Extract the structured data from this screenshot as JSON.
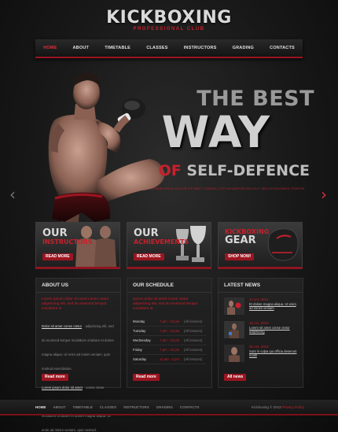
{
  "brand": {
    "logo": "KICKBOXING",
    "tagline": "PROFESSIONAL CLUB"
  },
  "nav": [
    {
      "label": "HOME",
      "active": true
    },
    {
      "label": "ABOUT",
      "active": false
    },
    {
      "label": "TIMETABLE",
      "active": false
    },
    {
      "label": "CLASSES",
      "active": false
    },
    {
      "label": "INSTRUCTORS",
      "active": false
    },
    {
      "label": "GRADING",
      "active": false
    },
    {
      "label": "CONTACTS",
      "active": false
    }
  ],
  "hero": {
    "line1": "THE BEST",
    "line2": "WAY",
    "line3_red": "OF",
    "line3_rest": "SELF-DEFENCE",
    "tagline": "LOREM IPSUM DOLOR SIT AMET CONSEC CTETUR ADIPISICING ELIT SED DO EIUSMOD TEMPOR",
    "prev_icon": "chevron-left-icon",
    "next_icon": "chevron-right-icon"
  },
  "promos": [
    {
      "title_top": "OUR",
      "title_bottom": "INSTRUCTORS",
      "button": "READ MORE"
    },
    {
      "title_top": "OUR",
      "title_bottom": "ACHIEVEMENTS",
      "button": "READ MORE"
    },
    {
      "title_top": "Kickboxing",
      "title_bottom": "GEAR",
      "button": "SHOP NOW!"
    }
  ],
  "about": {
    "title": "ABOUT US",
    "lead": "Lorem ipsum dolor sit amet conse ctetur adipisicing elit, sed do eiusmod tempor incididunt ut",
    "block1_link": "Dolor sit amet conse ctetur",
    "block1_text": "adipisicing elit, sed do eiusmod tempor incididunt ut labore et dolore magna aliqua. Ut enim ad minim veniam, quis nostrud exercitation.",
    "block2_link": "Lorem ipsum dolor sit amet",
    "block2_text": "conse ctetur adipisicing elit, sed do eiusmod tempor incididunt ut labore et dolore magna aliqua. Ut enim ad minim veniam, quis nostrud.",
    "button": "Read more"
  },
  "schedule": {
    "title": "OUR SCHEDULE",
    "lead": "Ipsum dolor sit amet conse ctetur adipisicing elit, sed do eiusmod tempor incididunt ut.",
    "rows": [
      {
        "day": "Monday",
        "time": "7 pm - 10 pm",
        "note": "(All lessons)"
      },
      {
        "day": "Tuesday",
        "time": "7 pm - 10 pm",
        "note": "(All lessons)"
      },
      {
        "day": "Wednesday",
        "time": "7 pm - 10 pm",
        "note": "(All lessons)"
      },
      {
        "day": "Friday",
        "time": "7 pm - 10 pm",
        "note": "(All lessons)"
      },
      {
        "day": "Saturday",
        "time": "11 am - 2 pm",
        "note": "(All lessons)"
      }
    ],
    "button": "Read more"
  },
  "news": {
    "title": "LATEST NEWS",
    "items": [
      {
        "date": "11 oct, 2012",
        "text": "Et dolore magna aliqua. Ut enim ad minim veniam"
      },
      {
        "date": "15 oct, 2012",
        "text": "Lorem sit amet conse ctetur adipisicing"
      },
      {
        "date": "20 oct, 2012",
        "text": "Sunt in culpa qui officia deserunt mollit"
      }
    ],
    "button": "All news"
  },
  "footer": {
    "nav": [
      {
        "label": "HOME",
        "active": true
      },
      {
        "label": "ABOUT",
        "active": false
      },
      {
        "label": "TIMETABLE",
        "active": false
      },
      {
        "label": "CLASSES",
        "active": false
      },
      {
        "label": "INSTRUCTORS",
        "active": false
      },
      {
        "label": "GRADING",
        "active": false
      },
      {
        "label": "CONTACTS",
        "active": false
      }
    ],
    "copyright": "Kickboxing © 2012",
    "privacy": "Privacy Policy"
  },
  "colors": {
    "accent": "#c8202c",
    "accent_dark": "#9b1520",
    "background": "#181818"
  }
}
